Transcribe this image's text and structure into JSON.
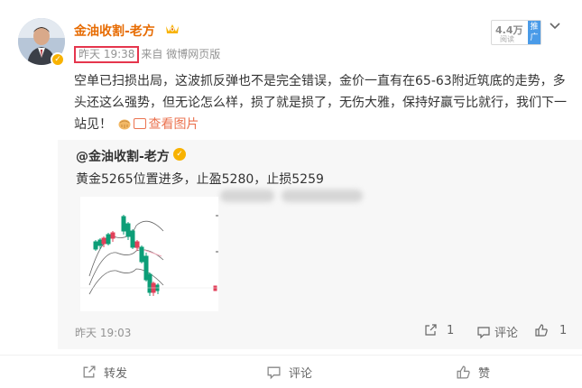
{
  "post": {
    "author": "金油收割-老方",
    "time": "昨天 19:38",
    "source": "来自 微博网页版",
    "reads": "4.4万",
    "reads_label": "阅读",
    "promo_label": "推广",
    "text_main": "空单已扫损出局，这波抓反弹也不是完全错误，金价一直有在65-63附近筑底的走势，多头还这么强势，但无论怎么样，损了就是损了，无伤大雅，保持好赢亏比就行，我们下一站见！",
    "pic_link": "查看图片"
  },
  "repost": {
    "author": "@金油收割-老方",
    "text": "黄金5265位置进多，止盈5280，止损5259",
    "time": "昨天 19:03",
    "share_count": "1",
    "comment_label": "评论",
    "like_count": "1"
  },
  "footer": {
    "repost_label": "转发",
    "comment_label": "评论",
    "like_label": "赞"
  },
  "colors": {
    "author": "#e76c03",
    "highlight_box": "#e5364d",
    "link": "#eb7350",
    "verified": "#f8b200"
  }
}
